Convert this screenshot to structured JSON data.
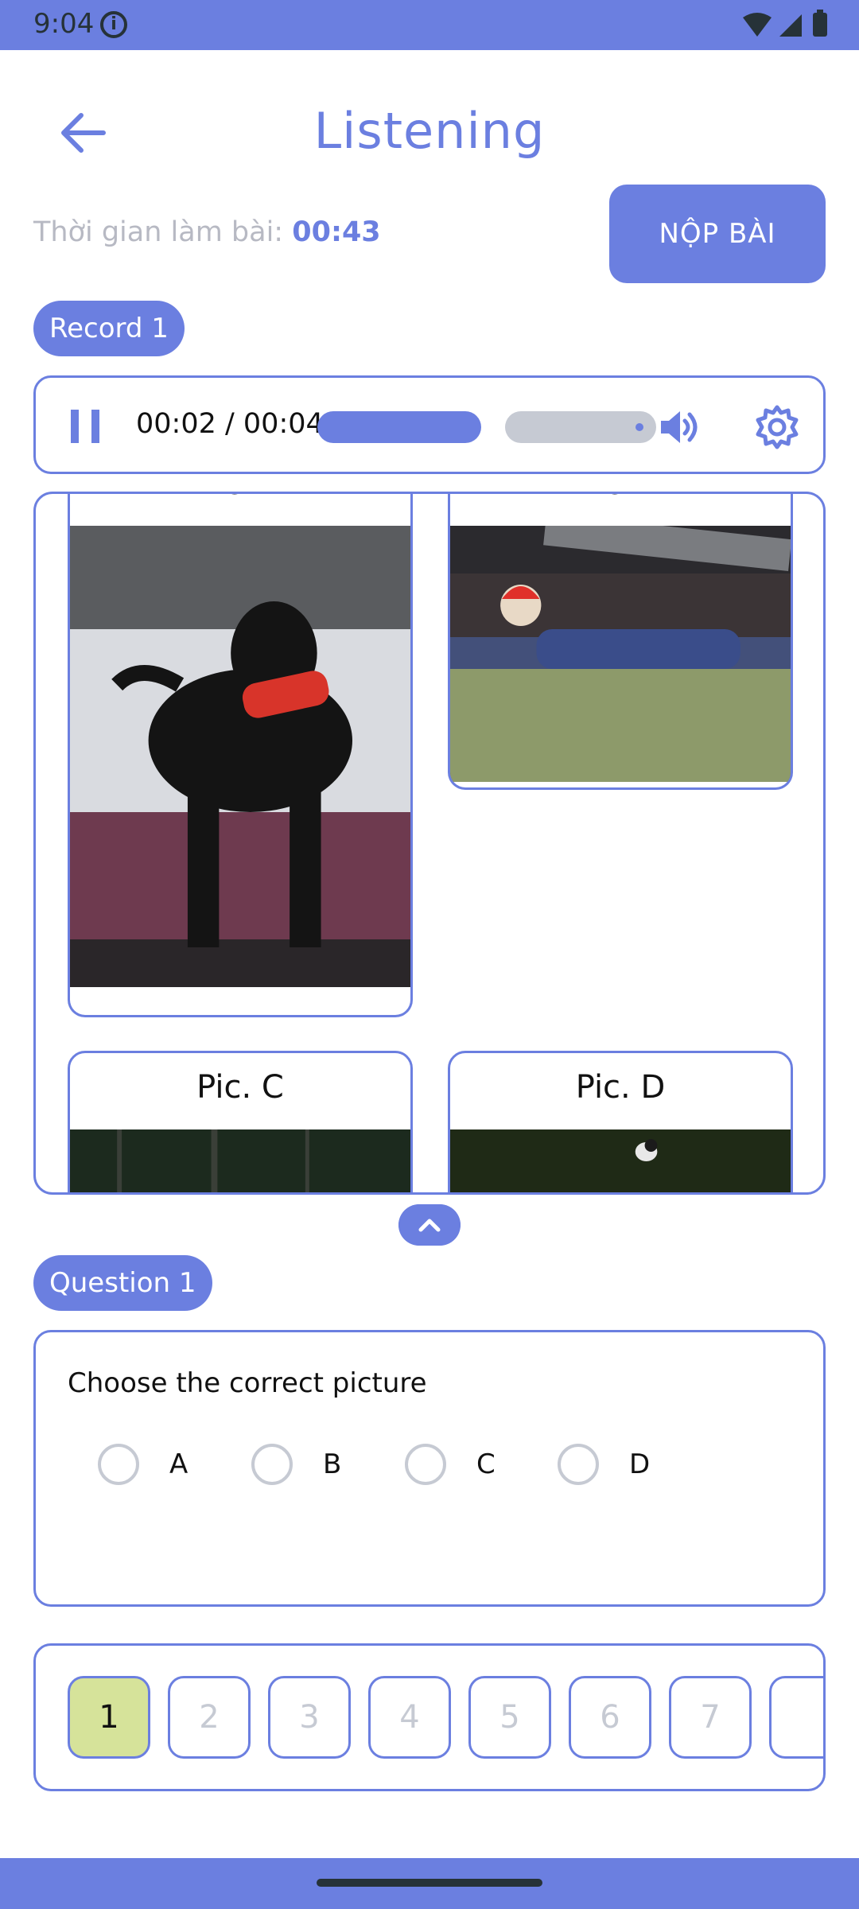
{
  "status_bar": {
    "time": "9:04"
  },
  "header": {
    "title": "Listening"
  },
  "timer": {
    "label": "Thời gian làm bài:",
    "value": "00:43"
  },
  "submit_label": "NỘP BÀI",
  "record": {
    "label": "Record 1",
    "time": "00:02 / 00:04",
    "progress_fraction": 0.5
  },
  "pictures": [
    {
      "id": "A",
      "caption": "Pic. A"
    },
    {
      "id": "B",
      "caption": "Pic. B"
    },
    {
      "id": "C",
      "caption": "Pic. C"
    },
    {
      "id": "D",
      "caption": "Pic. D"
    }
  ],
  "question": {
    "label": "Question 1",
    "prompt": "Choose the correct picture",
    "options": [
      "A",
      "B",
      "C",
      "D"
    ]
  },
  "question_nav": {
    "numbers": [
      "1",
      "2",
      "3",
      "4",
      "5",
      "6",
      "7"
    ],
    "active": "1"
  },
  "colors": {
    "accent": "#6b7fe0",
    "active_question": "#d6e39a",
    "muted": "#c6cad3"
  }
}
